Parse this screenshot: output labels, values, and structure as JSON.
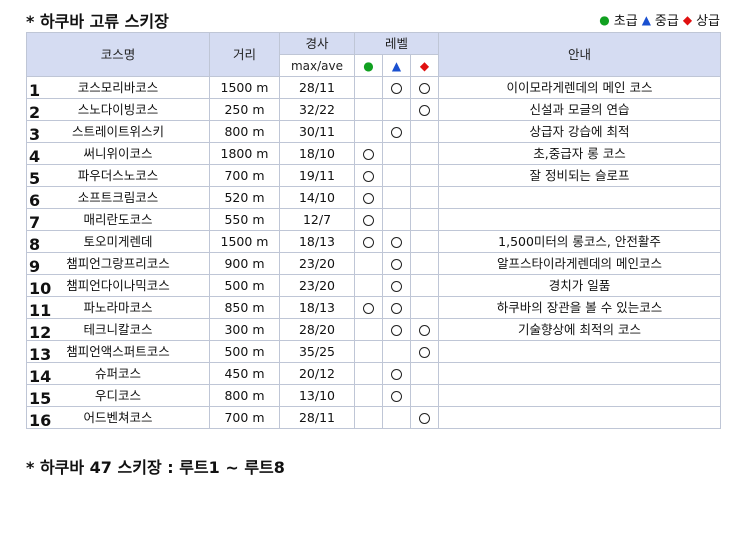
{
  "title": "* 하쿠바 고류 스키장",
  "legend": [
    {
      "symbol": "●",
      "label": "초급",
      "color": "#10a020",
      "cls": "g"
    },
    {
      "symbol": "▲",
      "label": "중급",
      "color": "#1a50d0",
      "cls": "b"
    },
    {
      "symbol": "◆",
      "label": "상급",
      "color": "#e01010",
      "cls": "r"
    }
  ],
  "headers": {
    "course": "코스명",
    "distance": "거리",
    "slope": "경사",
    "slope_sub": "max/ave",
    "level": "레벨",
    "guide": "안내",
    "level_symbols": [
      "●",
      "▲",
      "◆"
    ]
  },
  "rows": [
    {
      "num": "1",
      "name": "코스모리바코스",
      "dist": "1500 m",
      "slope": "28/11",
      "beg": false,
      "int": true,
      "adv": true,
      "info": "이이모라게렌데의 메인 코스"
    },
    {
      "num": "2",
      "name": "스노다이빙코스",
      "dist": "250 m",
      "slope": "32/22",
      "beg": false,
      "int": false,
      "adv": true,
      "info": "신설과 모글의 연습"
    },
    {
      "num": "3",
      "name": "스트레이트위스키",
      "dist": "800 m",
      "slope": "30/11",
      "beg": false,
      "int": true,
      "adv": false,
      "info": "상급자 강습에 최적"
    },
    {
      "num": "4",
      "name": "써니위이코스",
      "dist": "1800 m",
      "slope": "18/10",
      "beg": true,
      "int": false,
      "adv": false,
      "info": "초,중급자 롱 코스"
    },
    {
      "num": "5",
      "name": "파우더스노코스",
      "dist": "700 m",
      "slope": "19/11",
      "beg": true,
      "int": false,
      "adv": false,
      "info": "잘 정비되는 슬로프"
    },
    {
      "num": "6",
      "name": "소프트크림코스",
      "dist": "520 m",
      "slope": "14/10",
      "beg": true,
      "int": false,
      "adv": false,
      "info": ""
    },
    {
      "num": "7",
      "name": "매리란도코스",
      "dist": "550 m",
      "slope": "12/7",
      "beg": true,
      "int": false,
      "adv": false,
      "info": ""
    },
    {
      "num": "8",
      "name": "토오미게렌데",
      "dist": "1500 m",
      "slope": "18/13",
      "beg": true,
      "int": true,
      "adv": false,
      "info": "1,500미터의 롱코스, 안전활주"
    },
    {
      "num": "9",
      "name": "챔피언그랑프리코스",
      "dist": "900 m",
      "slope": "23/20",
      "beg": false,
      "int": true,
      "adv": false,
      "info": "알프스타이라게렌데의 메인코스"
    },
    {
      "num": "10",
      "name": "챔피언다이나믹코스",
      "dist": "500 m",
      "slope": "23/20",
      "beg": false,
      "int": true,
      "adv": false,
      "info": "경치가 일품"
    },
    {
      "num": "11",
      "name": "파노라마코스",
      "dist": "850 m",
      "slope": "18/13",
      "beg": true,
      "int": true,
      "adv": false,
      "info": "하쿠바의 장관을 볼 수 있는코스"
    },
    {
      "num": "12",
      "name": "테크니칼코스",
      "dist": "300 m",
      "slope": "28/20",
      "beg": false,
      "int": true,
      "adv": true,
      "info": "기술향상에 최적의 코스"
    },
    {
      "num": "13",
      "name": "챔피언액스퍼트코스",
      "dist": "500 m",
      "slope": "35/25",
      "beg": false,
      "int": false,
      "adv": true,
      "info": ""
    },
    {
      "num": "14",
      "name": "슈퍼코스",
      "dist": "450 m",
      "slope": "20/12",
      "beg": false,
      "int": true,
      "adv": false,
      "info": ""
    },
    {
      "num": "15",
      "name": "우디코스",
      "dist": "800 m",
      "slope": "13/10",
      "beg": false,
      "int": true,
      "adv": false,
      "info": ""
    },
    {
      "num": "16",
      "name": "어드벤쳐코스",
      "dist": "700 m",
      "slope": "28/11",
      "beg": false,
      "int": false,
      "adv": true,
      "info": ""
    }
  ],
  "footer": "* 하쿠바 47 스키장 : 루트1 ~ 루트8"
}
